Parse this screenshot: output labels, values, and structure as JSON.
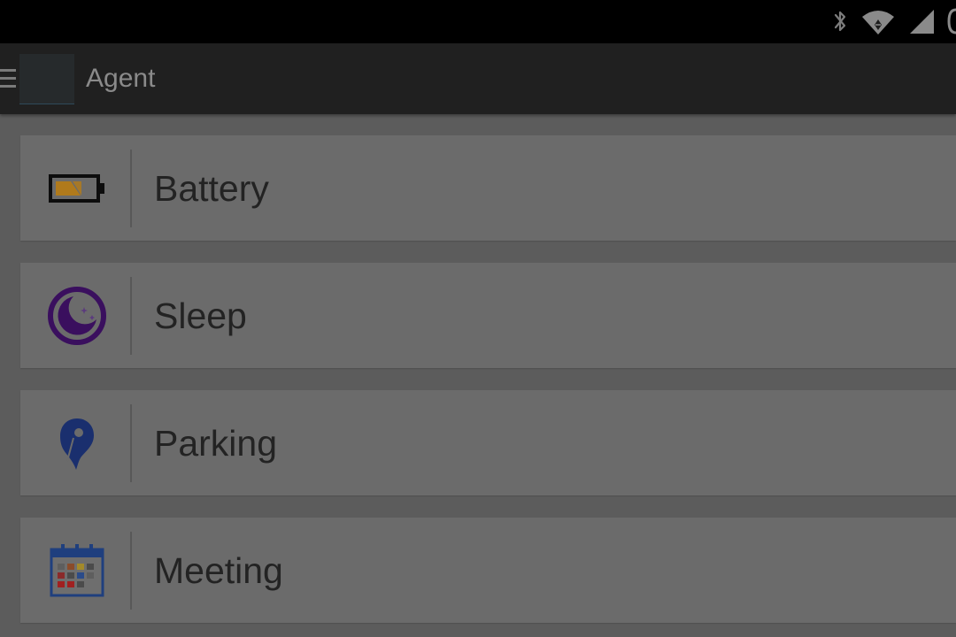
{
  "status_bar": {
    "icons": [
      "bluetooth-icon",
      "wifi-icon",
      "cell-signal-icon",
      "battery-icon"
    ]
  },
  "app_bar": {
    "title": "Agent",
    "icons": [
      "drawer-menu-icon",
      "app-logo"
    ]
  },
  "agents": [
    {
      "label": "Battery",
      "icon": "battery-icon",
      "color": "#b07a1c"
    },
    {
      "label": "Sleep",
      "icon": "moon-icon",
      "color": "#3a0f5e"
    },
    {
      "label": "Parking",
      "icon": "map-pin-icon",
      "color": "#1a2f6e"
    },
    {
      "label": "Meeting",
      "icon": "calendar-icon",
      "color": "#1f3f7e"
    }
  ]
}
